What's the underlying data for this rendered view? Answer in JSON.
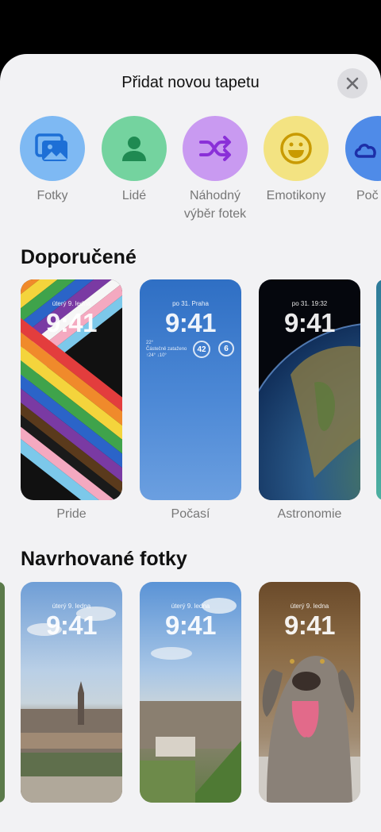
{
  "header": {
    "title": "Přidat novou tapetu"
  },
  "categories": [
    {
      "label": "Fotky",
      "icon": "photos-icon",
      "color": "#7eb9f3"
    },
    {
      "label": "Lidé",
      "icon": "person-icon",
      "color": "#74d39f"
    },
    {
      "label": "Náhodný výběr fotek",
      "icon": "shuffle-icon",
      "color": "#c99af1"
    },
    {
      "label": "Emotikony",
      "icon": "emoji-icon",
      "color": "#f3e382"
    },
    {
      "label": "Poč",
      "icon": "weather-icon",
      "color": "#4f8be8"
    }
  ],
  "recommended": {
    "title": "Doporučené",
    "items": [
      {
        "label": "Pride",
        "date": "úterý 9. ledna",
        "time": "9:41"
      },
      {
        "label": "Počasí",
        "date": "po 31.  Praha",
        "time": "9:41",
        "widgets": {
          "temp": "22°",
          "desc": "Částečně zataženo",
          "range": "↑24° ↓10°",
          "ring1": "42",
          "ring2": "6"
        }
      },
      {
        "label": "Astronomie",
        "date": "po 31.  19:32",
        "time": "9:41"
      }
    ]
  },
  "suggested": {
    "title": "Navrhované fotky",
    "items": [
      {
        "date": "úterý 9. ledna",
        "time": "9:41"
      },
      {
        "date": "úterý 9. ledna",
        "time": "9:41"
      },
      {
        "date": "úterý 9. ledna",
        "time": "9:41"
      }
    ]
  }
}
